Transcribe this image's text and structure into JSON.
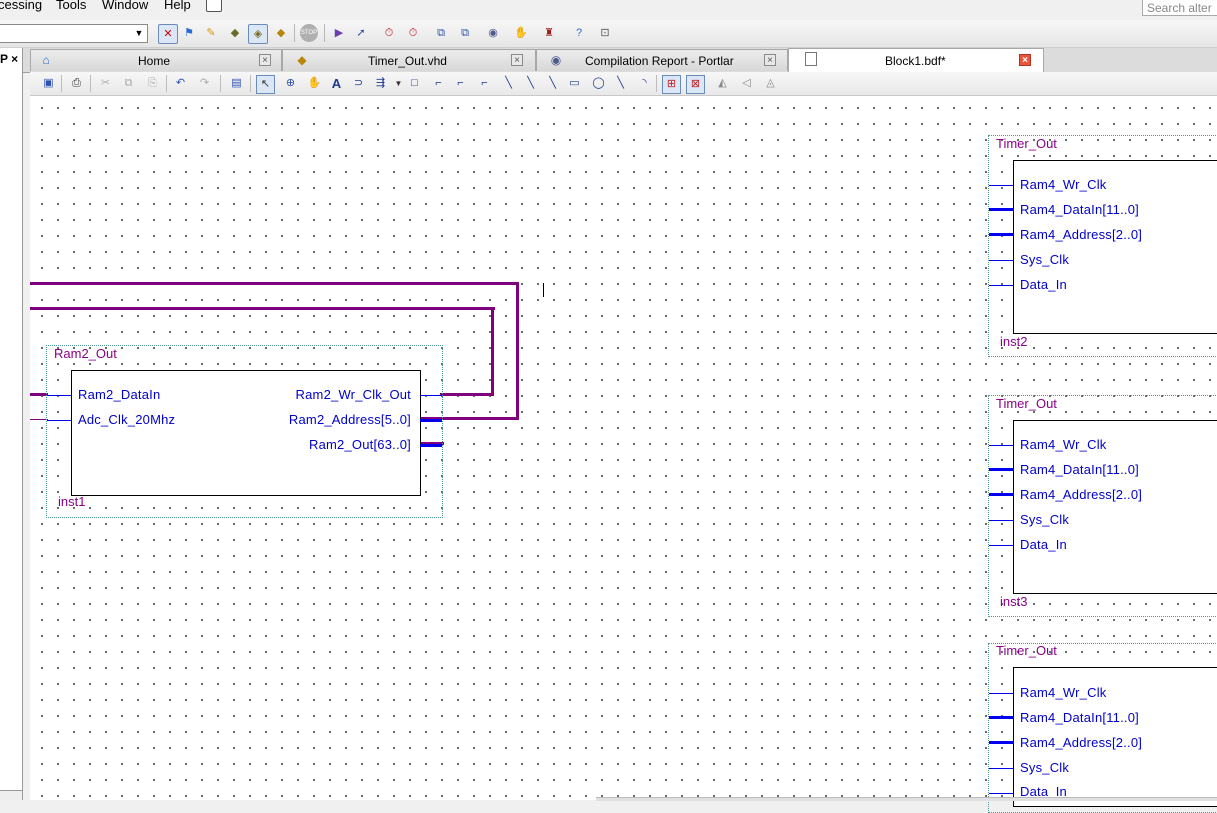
{
  "menu": {
    "items": [
      "cessing",
      "Tools",
      "Window",
      "Help"
    ]
  },
  "search": {
    "placeholder": "Search alter"
  },
  "left_panel": {
    "header": "P ×"
  },
  "tabs": [
    {
      "label": "Home",
      "icon": "home-icon",
      "active": false
    },
    {
      "label": "Timer_Out.vhd",
      "icon": "vhdl-file-icon",
      "active": false
    },
    {
      "label": "Compilation Report - Portlar",
      "icon": "report-icon",
      "active": false
    },
    {
      "label": "Block1.bdf*",
      "icon": "block-diagram-file-icon",
      "active": true
    }
  ],
  "schematic": {
    "ram2_block": {
      "title": "Ram2_Out",
      "instance": "inst1",
      "inputs": [
        "Ram2_DataIn",
        "Adc_Clk_20Mhz"
      ],
      "outputs": [
        "Ram2_Wr_Clk_Out",
        "Ram2_Address[5..0]",
        "Ram2_Out[63..0]"
      ]
    },
    "timer_blocks": [
      {
        "title": "Timer_Out",
        "instance": "inst2",
        "inputs": [
          "Ram4_Wr_Clk",
          "Ram4_DataIn[11..0]",
          "Ram4_Address[2..0]",
          "Sys_Clk",
          "Data_In"
        ]
      },
      {
        "title": "Timer_Out",
        "instance": "inst3",
        "inputs": [
          "Ram4_Wr_Clk",
          "Ram4_DataIn[11..0]",
          "Ram4_Address[2..0]",
          "Sys_Clk",
          "Data_In"
        ]
      },
      {
        "title": "Timer_Out",
        "instance": "",
        "inputs": [
          "Ram4_Wr_Clk",
          "Ram4_DataIn[11..0]",
          "Ram4_Address[2..0]",
          "Sys_Clk",
          "Data_In"
        ]
      }
    ]
  },
  "colors": {
    "wire": "#800080",
    "pin_text": "#0000cc",
    "block_title": "#8a008a",
    "grid_dot": "#3b4a4a"
  }
}
